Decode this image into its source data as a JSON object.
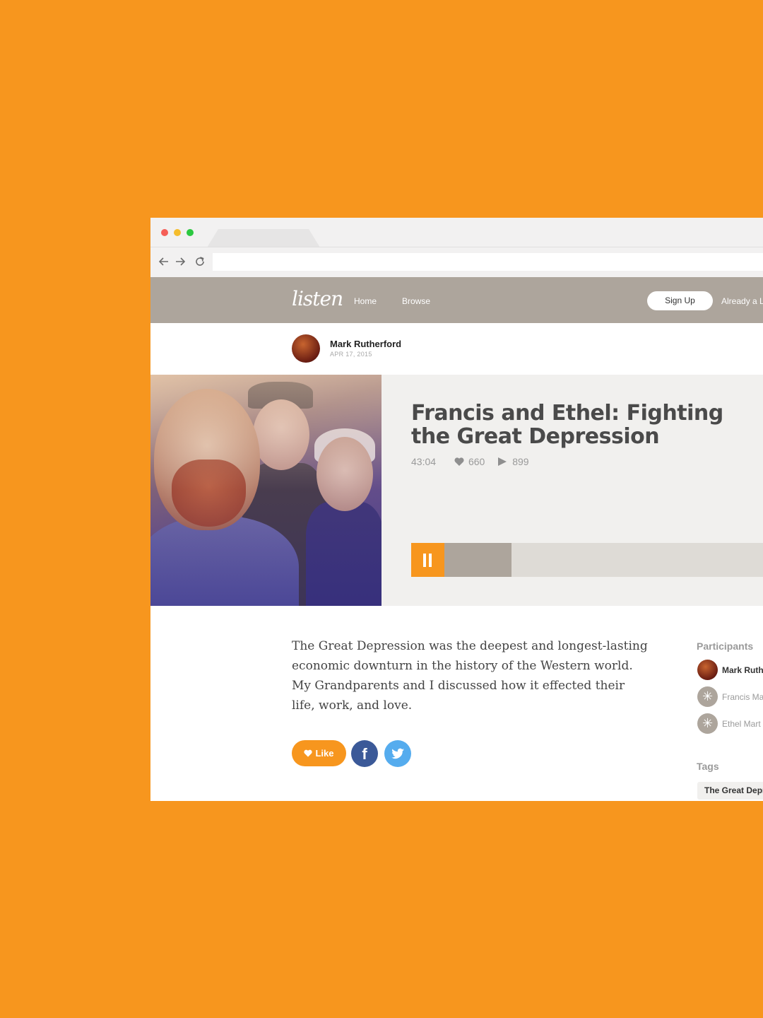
{
  "site": {
    "logo": "listen",
    "nav": [
      "Home",
      "Browse"
    ],
    "signup_label": "Sign Up",
    "login_prompt": "Already a L"
  },
  "author": {
    "name": "Mark Rutherford",
    "date": "APR 17, 2015"
  },
  "episode": {
    "title": "Francis and Ethel: Fighting the Great Depression",
    "duration": "43:04",
    "likes": "660",
    "plays": "899",
    "progress_fraction": 0.19,
    "description": "The Great Depression was the deepest and longest-lasting economic downturn in the history of the Western world. My Grandparents and I discussed how it effected their life, work, and love."
  },
  "actions": {
    "like_label": "Like"
  },
  "sidebar": {
    "participants_heading": "Participants",
    "participants": [
      "Mark Ruth",
      "Francis Ma",
      "Ethel Mart"
    ],
    "tags_heading": "Tags",
    "tags": [
      "The Great Depr"
    ]
  },
  "colors": {
    "background": "#F7961E",
    "header": "#ADA59C",
    "accent": "#F7961E",
    "facebook": "#3B5998",
    "twitter": "#55ACEE"
  }
}
